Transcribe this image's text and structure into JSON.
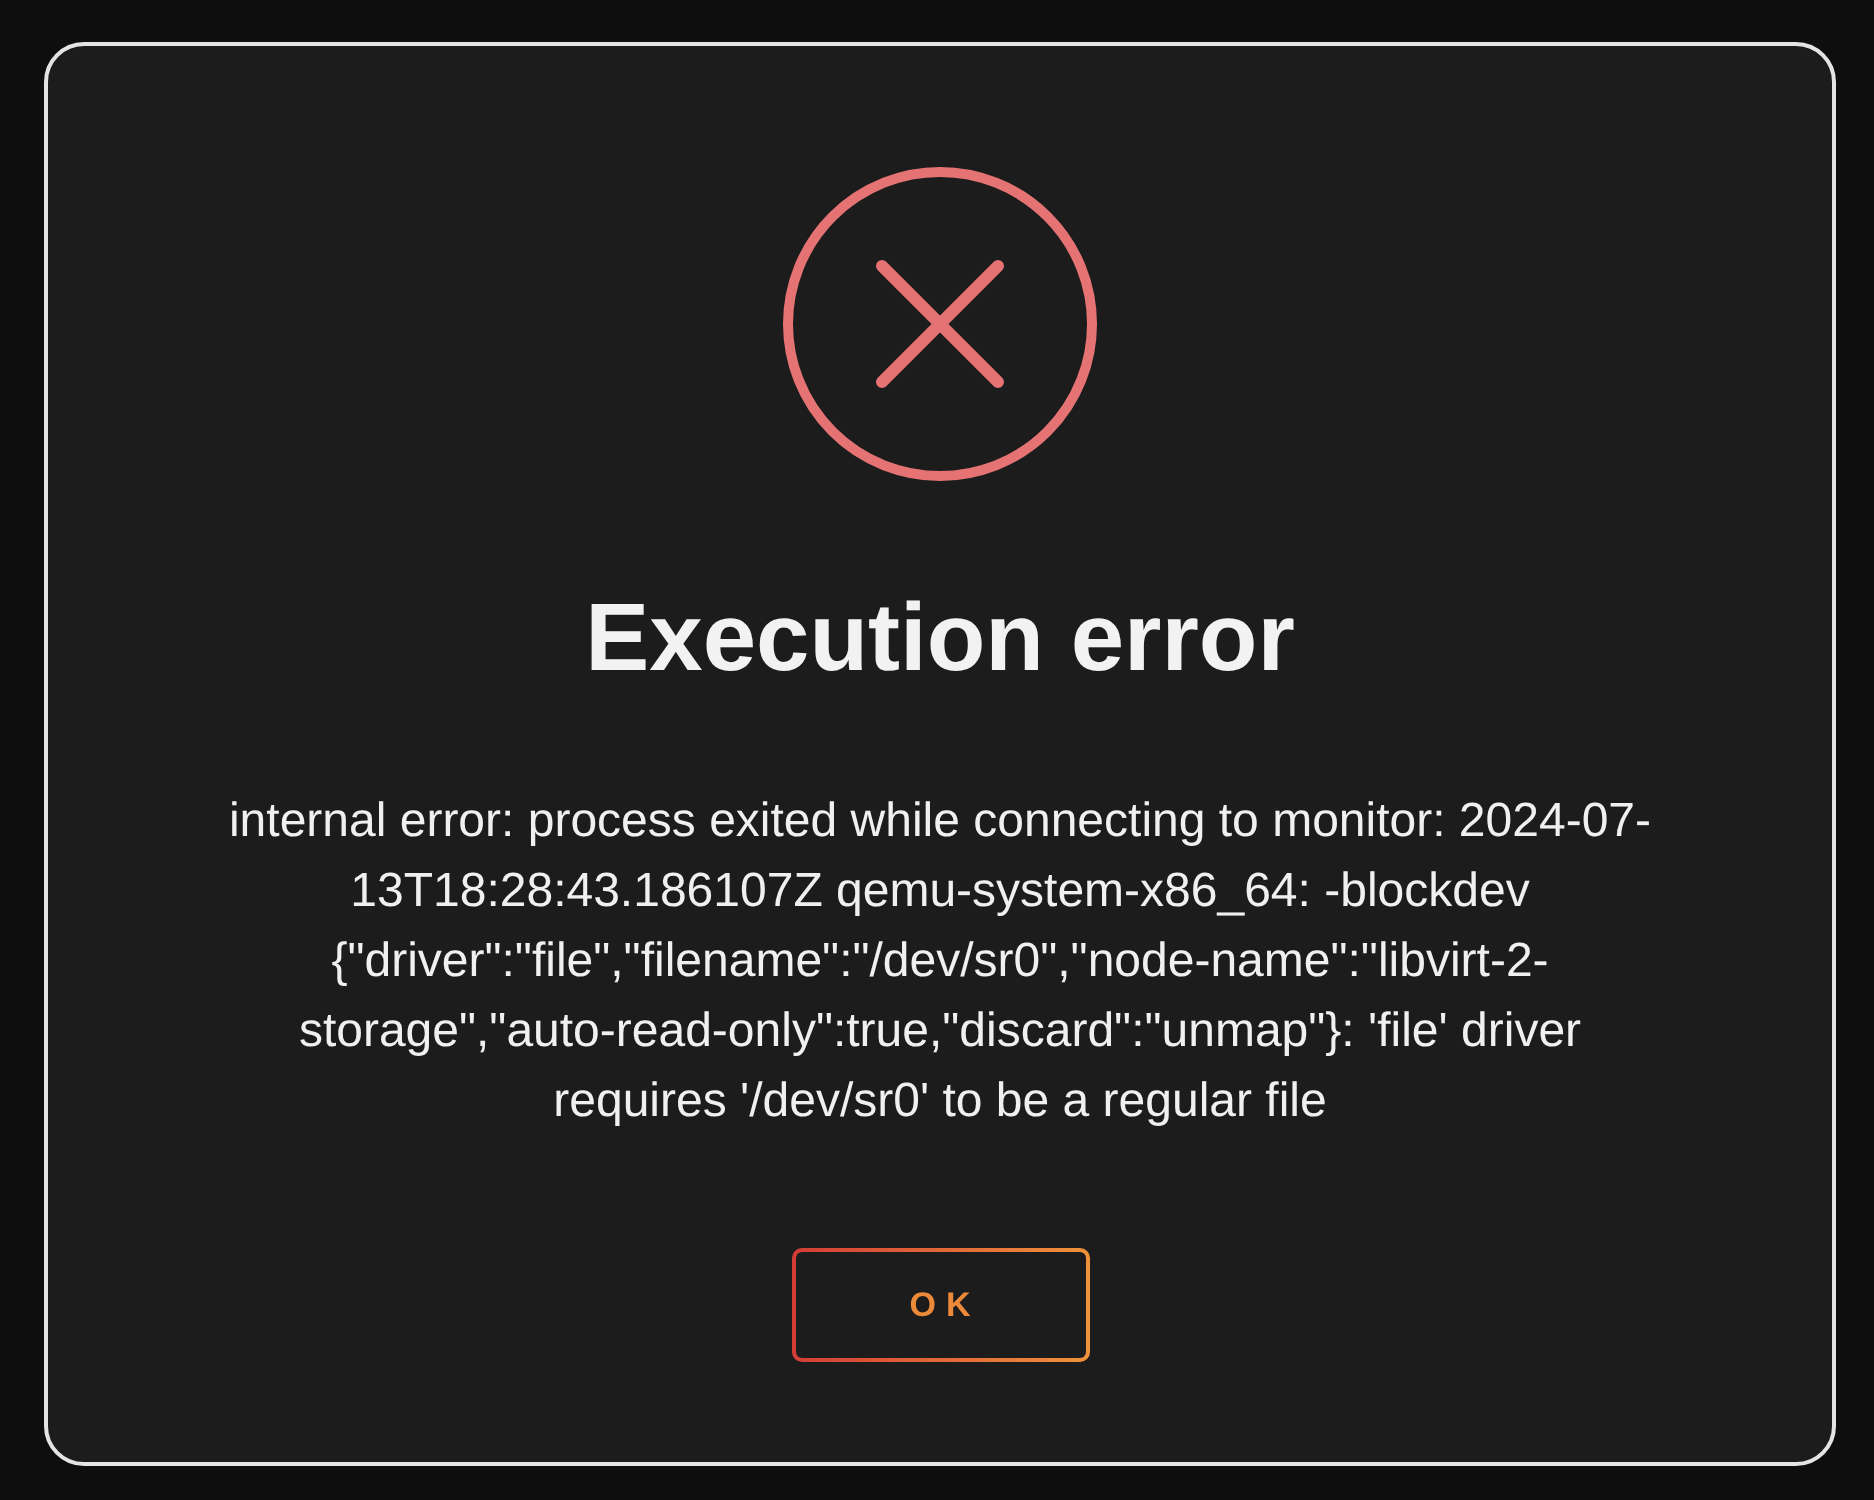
{
  "dialog": {
    "title": "Execution error",
    "message": "internal error: process exited while connecting to monitor: 2024-07-13T18:28:43.186107Z qemu-system-x86_64: -blockdev {\"driver\":\"file\",\"filename\":\"/dev/sr0\",\"node-name\":\"libvirt-2-storage\",\"auto-read-only\":true,\"discard\":\"unmap\"}: 'file' driver requires '/dev/sr0' to be a regular file",
    "buttons": [
      {
        "label": "OK"
      }
    ]
  }
}
